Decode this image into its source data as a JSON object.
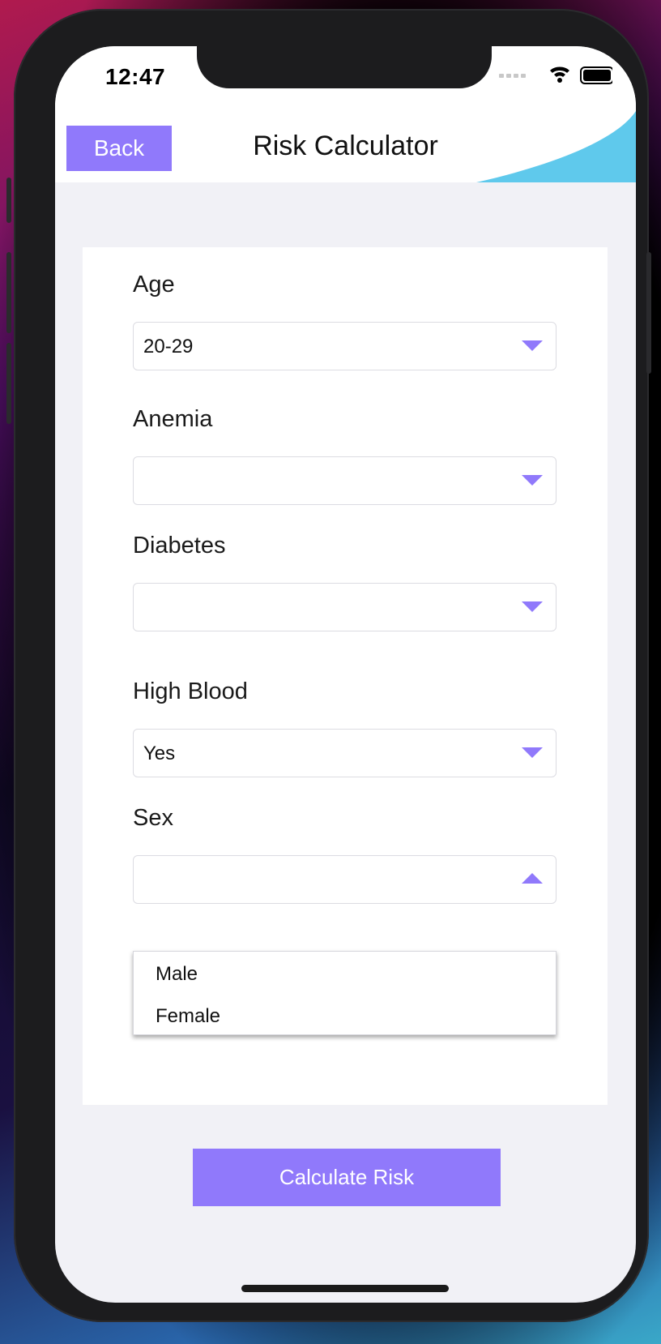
{
  "status_bar": {
    "time": "12:47",
    "icons": [
      "signal-dots-icon",
      "wifi-icon",
      "battery-icon"
    ]
  },
  "header": {
    "back_label": "Back",
    "title": "Risk Calculator"
  },
  "form": {
    "fields": [
      {
        "label": "Age",
        "value": "20-29",
        "expanded": false
      },
      {
        "label": "Anemia",
        "value": "",
        "expanded": false
      },
      {
        "label": "Diabetes",
        "value": "",
        "expanded": false
      },
      {
        "label": "High Blood",
        "value": "Yes",
        "expanded": false
      },
      {
        "label": "Sex",
        "value": "",
        "expanded": true
      },
      {
        "label": "",
        "value": "",
        "expanded": false
      }
    ],
    "sex_options": [
      "Male",
      "Female"
    ]
  },
  "actions": {
    "calculate_label": "Calculate Risk"
  },
  "colors": {
    "accent": "#9079fb",
    "header_wave": "#5fc9ec",
    "screen_background": "#f1f1f6",
    "card_background": "#ffffff"
  }
}
